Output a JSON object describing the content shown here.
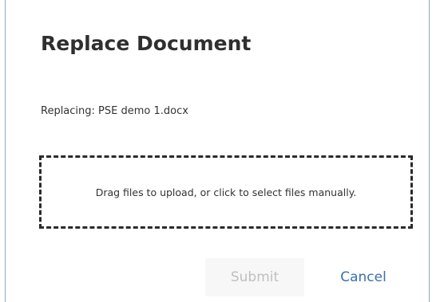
{
  "dialog": {
    "title": "Replace Document",
    "replacing_text": "Replacing: PSE demo 1.docx",
    "dropzone_text": "Drag files to upload, or click to select files manually.",
    "submit_label": "Submit",
    "cancel_label": "Cancel",
    "submit_disabled": true
  },
  "colors": {
    "border": "#8ea8c6",
    "title": "#2f2f2f",
    "link": "#3a6fb0",
    "disabled_text": "#bfbfbf",
    "disabled_bg": "#f7f7f7"
  }
}
